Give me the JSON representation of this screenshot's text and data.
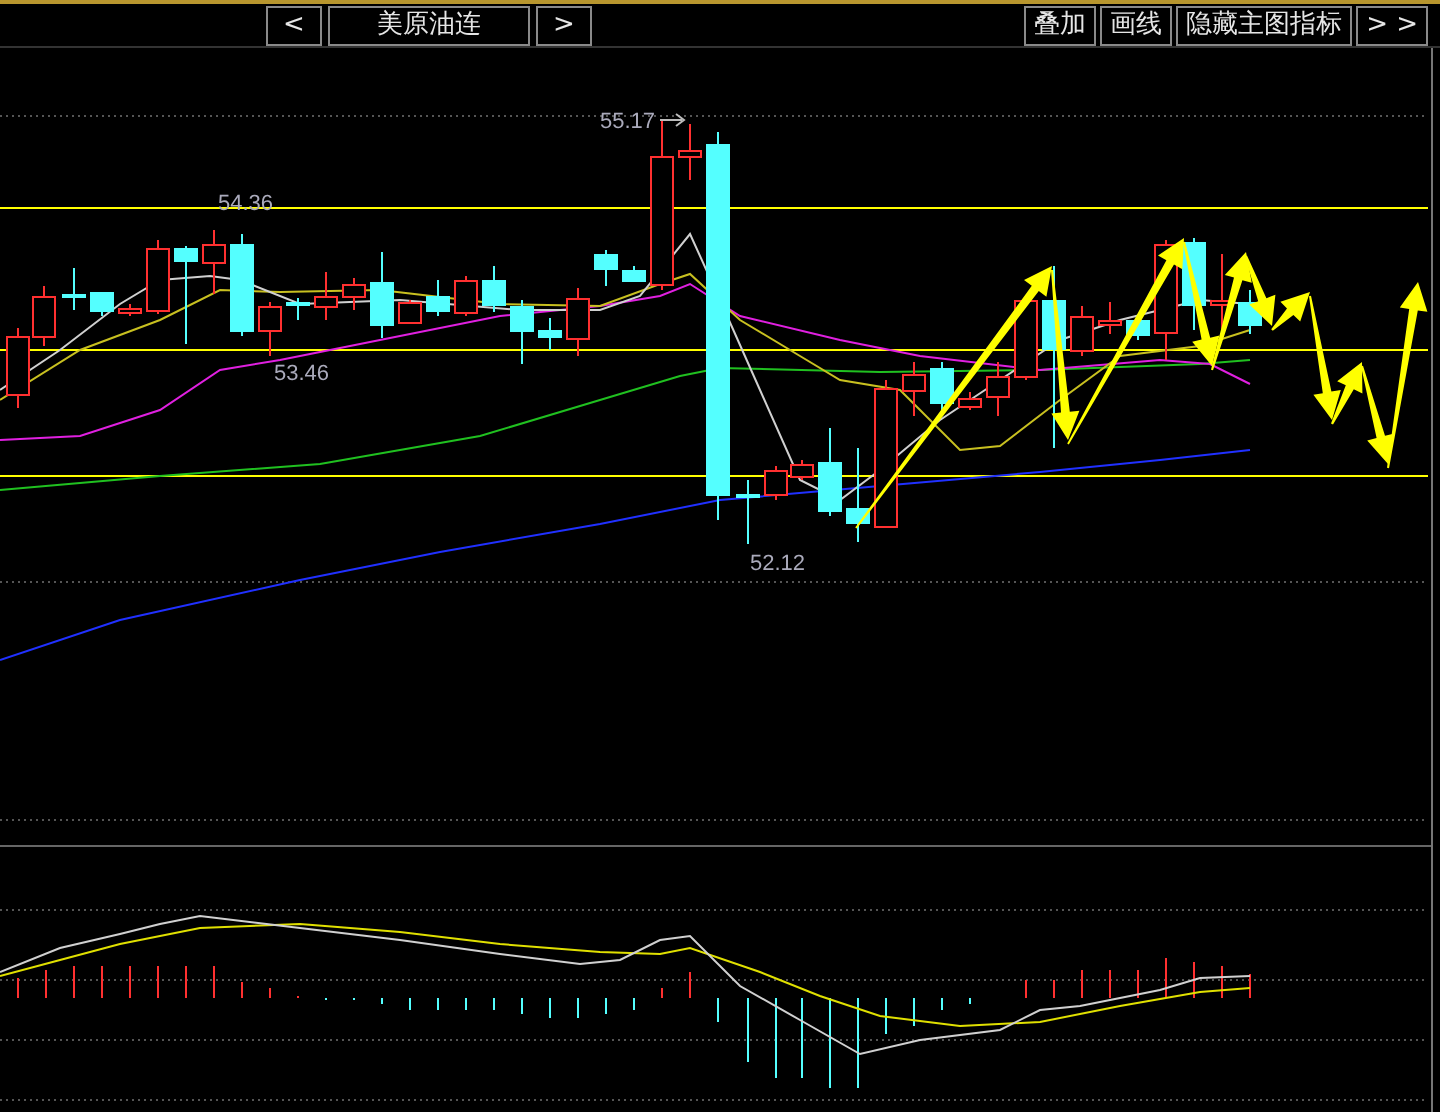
{
  "toolbar": {
    "prev_button": "<",
    "symbol": "美原油连",
    "next_button": ">",
    "buttons": [
      "叠加",
      "画线",
      "隐藏主图指标",
      "> >"
    ]
  },
  "price_labels": [
    "55.17",
    "54.36",
    "53.46",
    "52.12"
  ]
}
